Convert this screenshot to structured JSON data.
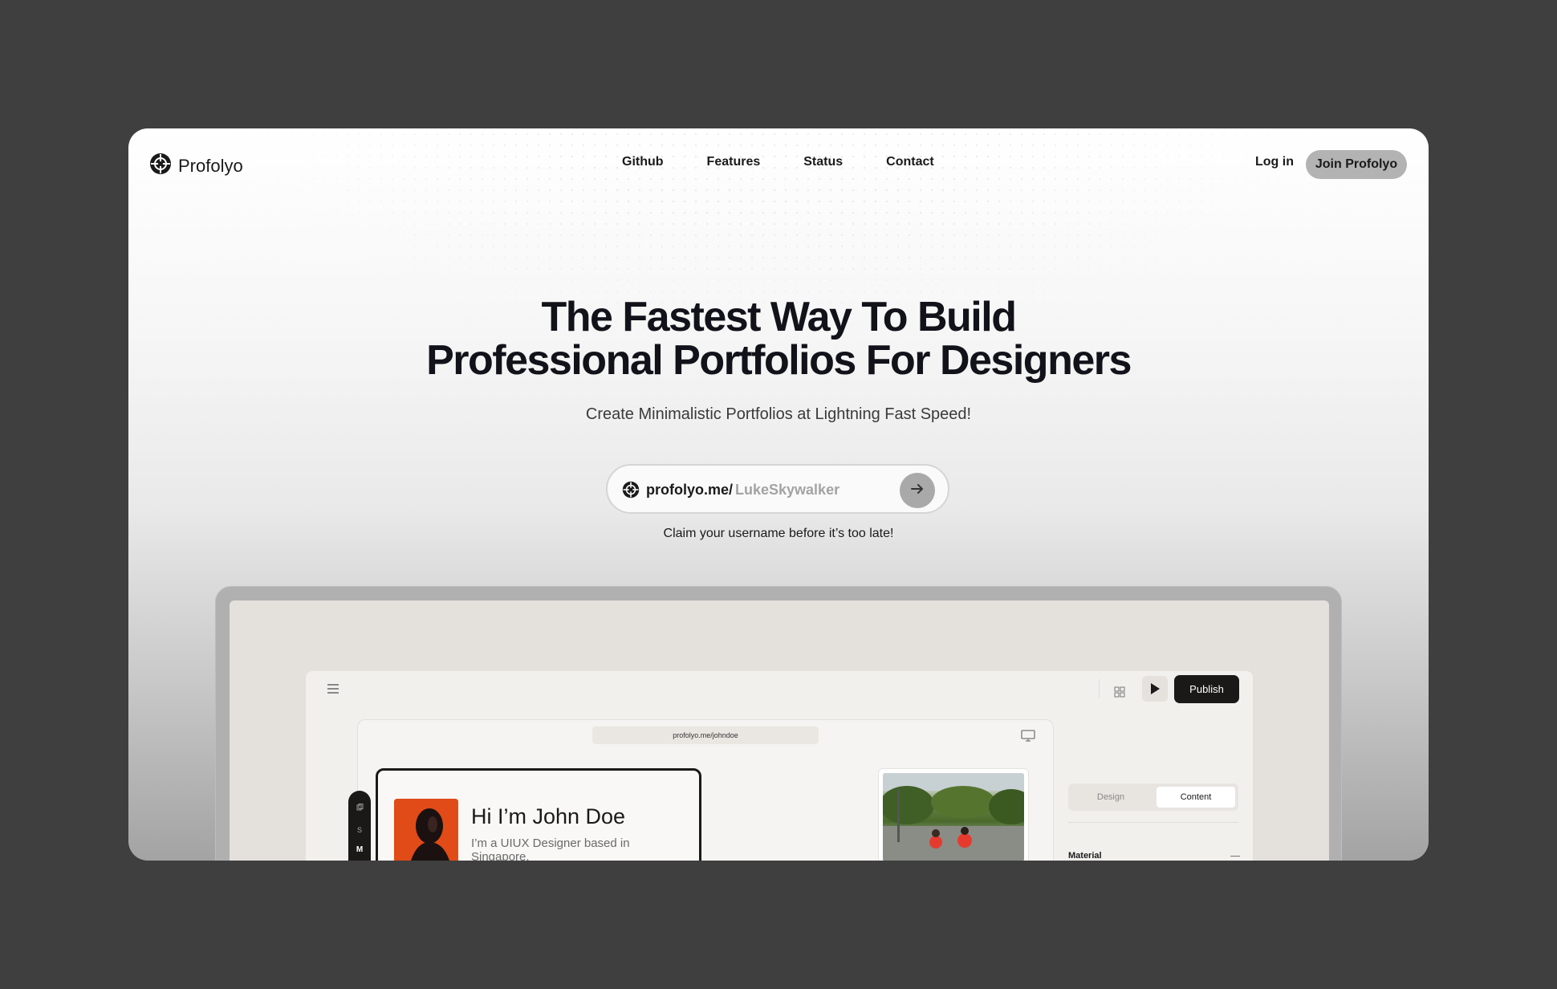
{
  "brand": {
    "name": "Profolyo"
  },
  "nav": {
    "links": [
      "Github",
      "Features",
      "Status",
      "Contact"
    ],
    "login": "Log in",
    "join": "Join Profolyo"
  },
  "hero": {
    "title_line1": "The Fastest Way To Build",
    "title_line2": "Professional Portfolios For Designers",
    "subtitle": "Create Minimalistic Portfolios at Lightning Fast Speed!"
  },
  "claim": {
    "prefix": "profolyo.me/",
    "placeholder": "LukeSkywalker",
    "note": "Claim your username before it’s too late!"
  },
  "preview": {
    "publish": "Publish",
    "url": "profolyo.me/johndoe",
    "card_title": "Hi I’m John Doe",
    "card_bio": "I’m a UIUX Designer based in Singapore.",
    "size_options": [
      "S",
      "M"
    ],
    "tabs": [
      "Design",
      "Content"
    ],
    "section": "Material"
  },
  "colors": {
    "backdrop": "#3f3f3f",
    "primary_dark": "#1b1918",
    "accent_orange": "#e04b18",
    "join_button": "#b3b3b3"
  },
  "icons": [
    "profolyo-logo-icon",
    "arrow-right-icon",
    "menu-icon",
    "grid-icon",
    "play-icon",
    "monitor-icon",
    "layers-icon",
    "minus-icon"
  ]
}
